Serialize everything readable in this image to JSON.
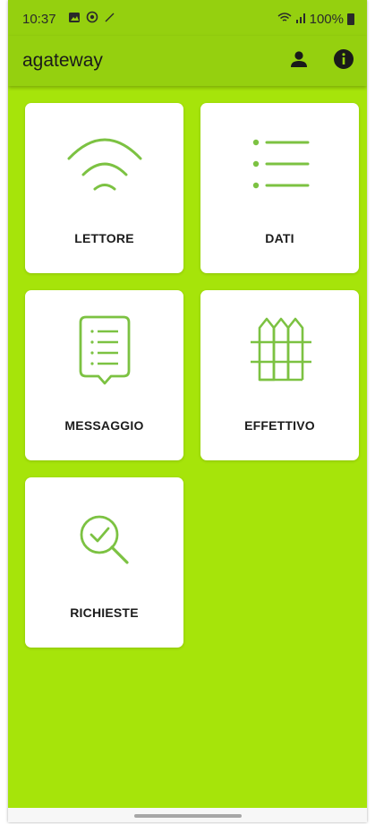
{
  "status_bar": {
    "time": "10:37",
    "battery": "100%",
    "icons_left": [
      "gallery-icon",
      "location-icon",
      "signal-icon"
    ],
    "icons_right": [
      "wifi-icon",
      "cell-signal-icon",
      "battery-icon"
    ]
  },
  "app_bar": {
    "title": "agateway",
    "actions": [
      "person-icon",
      "info-icon"
    ]
  },
  "tiles": [
    {
      "label": "LETTORE",
      "icon": "wifi-icon"
    },
    {
      "label": "DATI",
      "icon": "list-icon"
    },
    {
      "label": "MESSAGGIO",
      "icon": "message-icon"
    },
    {
      "label": "EFFETTIVO",
      "icon": "fence-icon"
    },
    {
      "label": "RICHIESTE",
      "icon": "search-check-icon"
    }
  ],
  "colors": {
    "background": "#a6e40a",
    "app_bar": "#95d00f",
    "icon_stroke": "#7cc242",
    "tile": "#ffffff"
  }
}
